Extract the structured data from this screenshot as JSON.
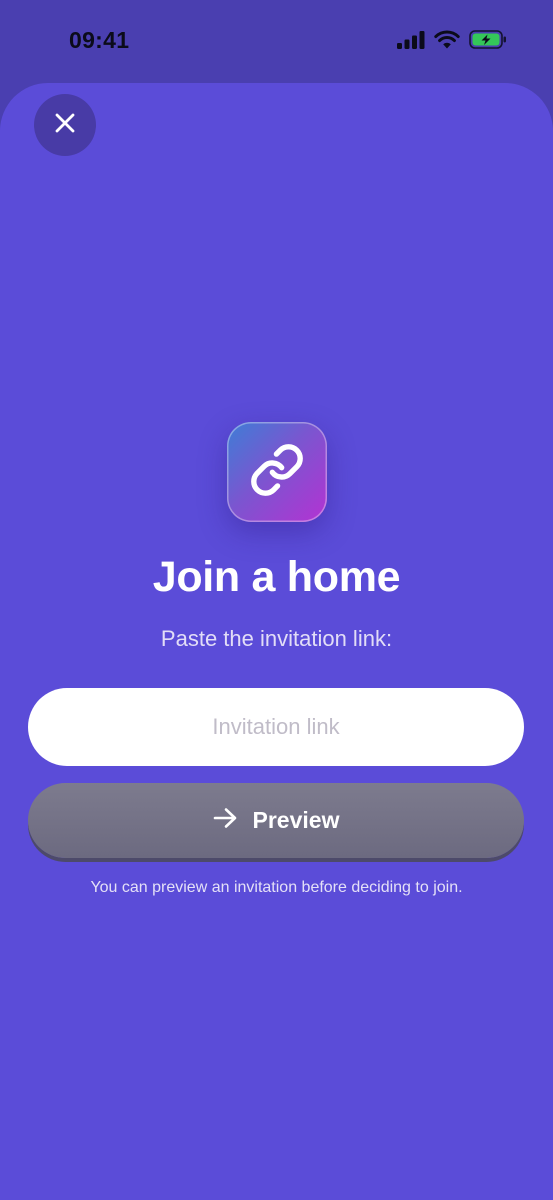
{
  "status_bar": {
    "time": "09:41",
    "icons": [
      "signal-icon",
      "wifi-icon",
      "battery-charging-icon"
    ]
  },
  "sheet": {
    "close_icon": "close-icon",
    "app_icon": "link-icon",
    "title": "Join a home",
    "subtitle": "Paste the invitation link:",
    "input": {
      "placeholder": "Invitation link",
      "value": ""
    },
    "preview_button": {
      "icon": "arrow-right-icon",
      "label": "Preview"
    },
    "hint": "You can preview an invitation before deciding to join."
  },
  "colors": {
    "background": "#4a3fb0",
    "sheet": "#5b4cd8",
    "close_button": "#483ba6",
    "button_disabled": "#74728a",
    "battery": "#34c759"
  }
}
